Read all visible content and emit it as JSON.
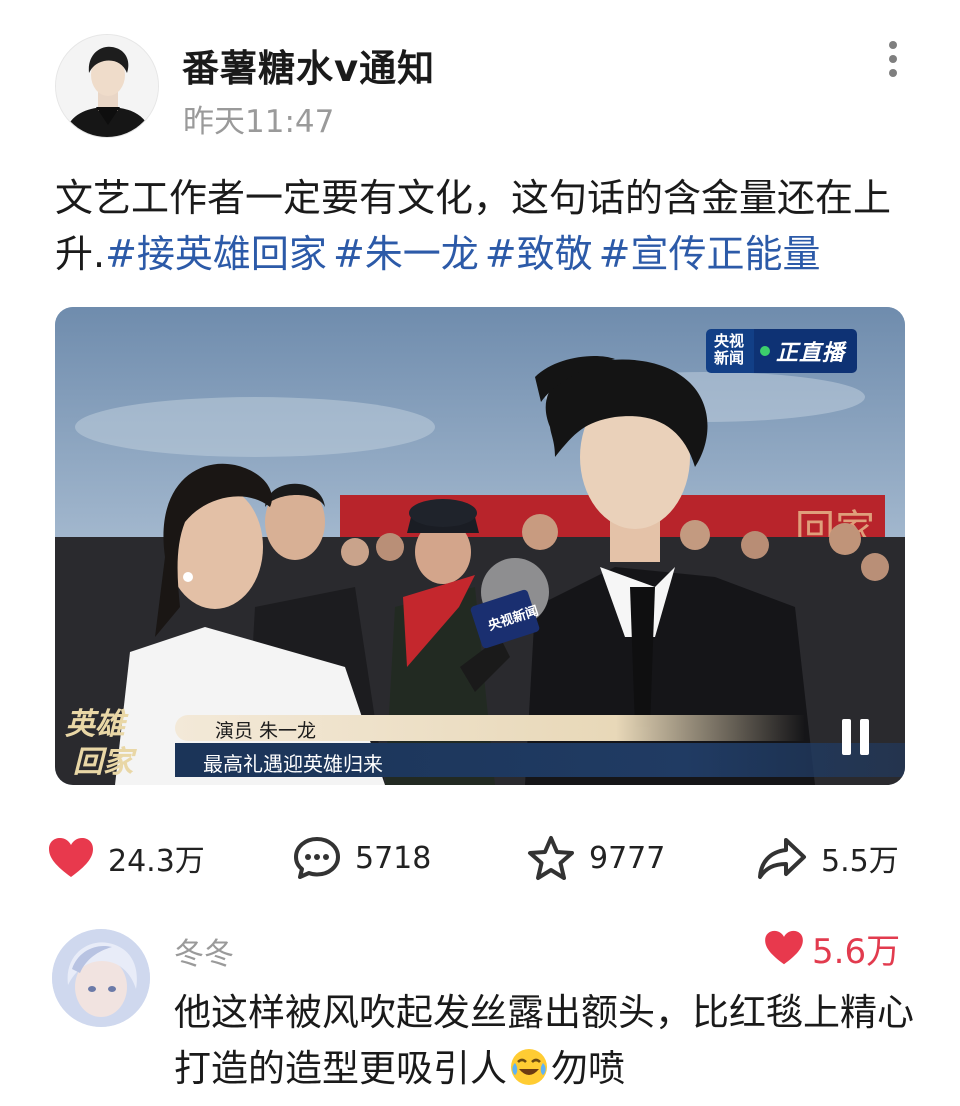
{
  "post": {
    "author": "番薯糖水v通知",
    "time": "昨天11:47",
    "text": "文艺工作者一定要有文化，这句话的含金量还在上升.",
    "hashtags": [
      "#接英雄回家",
      "#朱一龙",
      "#致敬",
      "#宣传正能量"
    ],
    "icons": {
      "avatar": "author-avatar",
      "more": "more-dots-icon"
    }
  },
  "video": {
    "channel_badge_left": "央视新闻",
    "channel_badge_right": "正直播",
    "show_logo_line1": "英雄",
    "show_logo_line2": "回家",
    "speaker_label": "演员 朱一龙",
    "caption": "最高礼遇迎英雄归来",
    "mic_badge": "央视新闻",
    "background_banner": "回家",
    "state_icon": "pause-icon"
  },
  "actions": {
    "likes": "24.3万",
    "comments": "5718",
    "favorites": "9777",
    "shares": "5.5万",
    "colors": {
      "like": "#e8394d",
      "icon": "#333333"
    }
  },
  "top_comment": {
    "name": "冬冬",
    "likes": "5.6万",
    "text_before_emoji": "他这样被风吹起发丝露出额头，比红毯上精心打造的造型更吸引人",
    "emoji": "crying-laughing-emoji",
    "text_after_emoji": "勿喷"
  }
}
